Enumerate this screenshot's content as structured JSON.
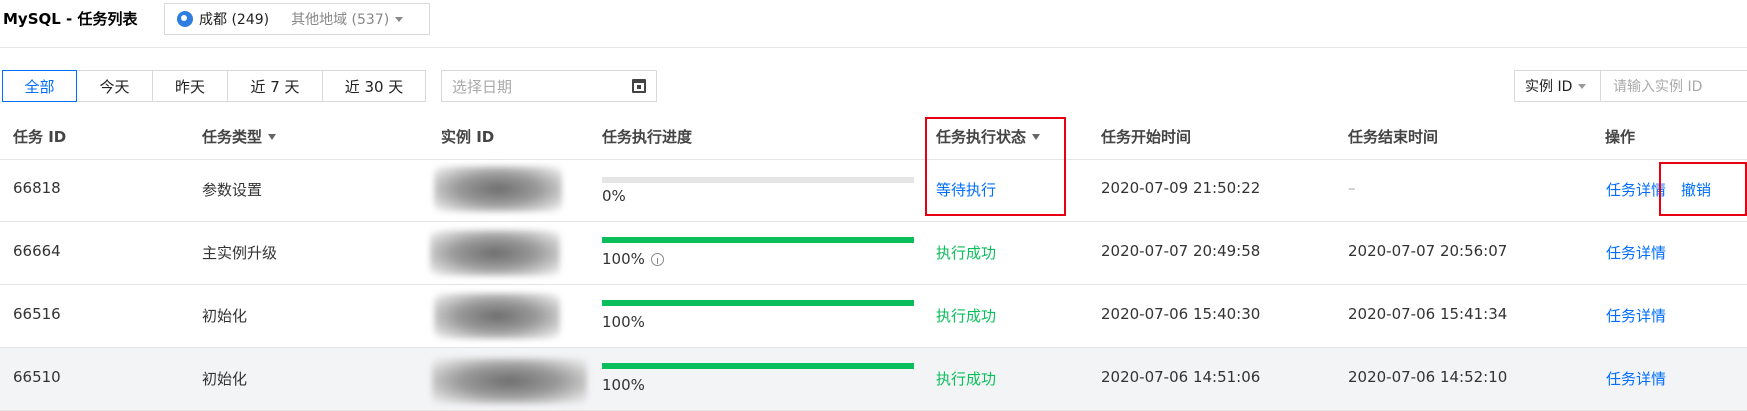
{
  "header": {
    "title": "MySQL - 任务列表",
    "region_current": "成都 (249)",
    "region_other": "其他地域 (537)"
  },
  "toolbar": {
    "tabs": [
      {
        "label": "全部",
        "active": true
      },
      {
        "label": "今天",
        "active": false
      },
      {
        "label": "昨天",
        "active": false
      },
      {
        "label": "近 7 天",
        "active": false
      },
      {
        "label": "近 30 天",
        "active": false
      }
    ],
    "date_placeholder": "选择日期",
    "instance_filter_label": "实例 ID",
    "instance_input_placeholder": "请输入实例 ID"
  },
  "table": {
    "columns": {
      "task_id": "任务 ID",
      "task_type": "任务类型",
      "instance_id": "实例 ID",
      "progress": "任务执行进度",
      "status": "任务执行状态",
      "start_time": "任务开始时间",
      "end_time": "任务结束时间",
      "actions": "操作"
    },
    "rows": [
      {
        "task_id": "66818",
        "task_type": "参数设置",
        "progress": 0,
        "progress_text": "0%",
        "status": "等待执行",
        "start_time": "2020-07-09 21:50:22",
        "end_time": "–",
        "detail": "任务详情",
        "cancel": "撤销"
      },
      {
        "task_id": "66664",
        "task_type": "主实例升级",
        "progress": 100,
        "progress_text": "100%",
        "status": "执行成功",
        "start_time": "2020-07-07 20:49:58",
        "end_time": "2020-07-07 20:56:07",
        "detail": "任务详情"
      },
      {
        "task_id": "66516",
        "task_type": "初始化",
        "progress": 100,
        "progress_text": "100%",
        "status": "执行成功",
        "start_time": "2020-07-06 15:40:30",
        "end_time": "2020-07-06 15:41:34",
        "detail": "任务详情"
      },
      {
        "task_id": "66510",
        "task_type": "初始化",
        "progress": 100,
        "progress_text": "100%",
        "status": "执行成功",
        "start_time": "2020-07-06 14:51:06",
        "end_time": "2020-07-06 14:52:10",
        "detail": "任务详情"
      }
    ]
  },
  "colors": {
    "primary": "#006eff",
    "success": "#0abf5b",
    "annotation": "#e60012"
  }
}
